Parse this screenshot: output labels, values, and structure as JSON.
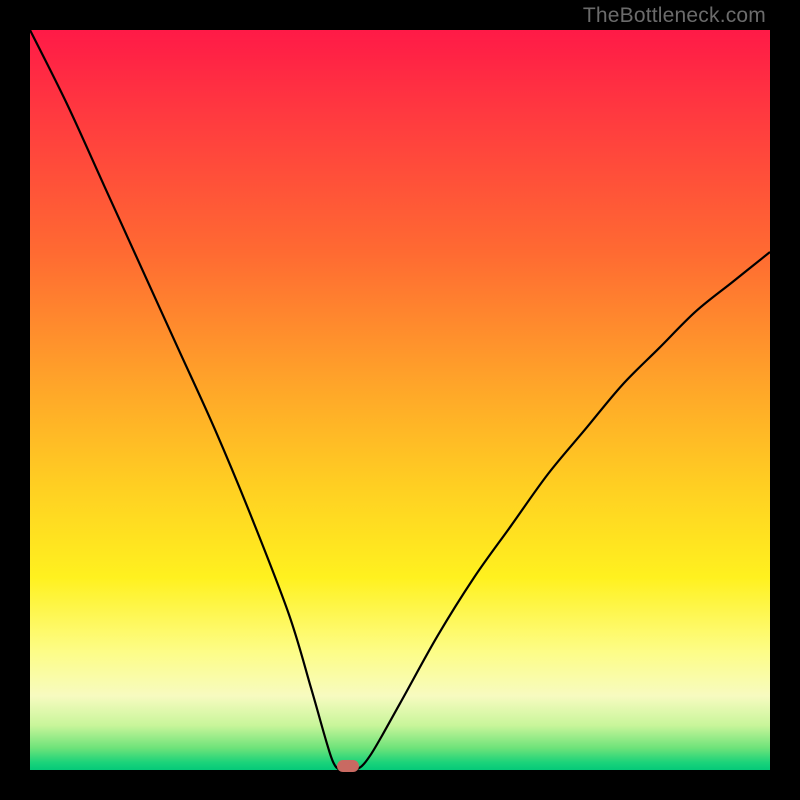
{
  "watermark": "TheBottleneck.com",
  "chart_data": {
    "type": "line",
    "title": "",
    "xlabel": "",
    "ylabel": "",
    "xlim": [
      0,
      100
    ],
    "ylim": [
      0,
      100
    ],
    "grid": false,
    "x": [
      0,
      5,
      10,
      15,
      20,
      25,
      30,
      35,
      38,
      40,
      41,
      42,
      44,
      46,
      50,
      55,
      60,
      65,
      70,
      75,
      80,
      85,
      90,
      95,
      100
    ],
    "values": [
      100,
      90,
      79,
      68,
      57,
      46,
      34,
      21,
      11,
      4,
      1,
      0,
      0,
      2,
      9,
      18,
      26,
      33,
      40,
      46,
      52,
      57,
      62,
      66,
      70
    ],
    "min_point": {
      "x": 42,
      "y": 0
    },
    "marker": {
      "x": 43,
      "y": 0.5,
      "color": "#c96a62"
    },
    "background_gradient": {
      "top": "#ff1a47",
      "mid_upper": "#ffa529",
      "mid": "#fff11f",
      "mid_lower": "#f7fbc0",
      "bottom": "#05c979"
    }
  }
}
